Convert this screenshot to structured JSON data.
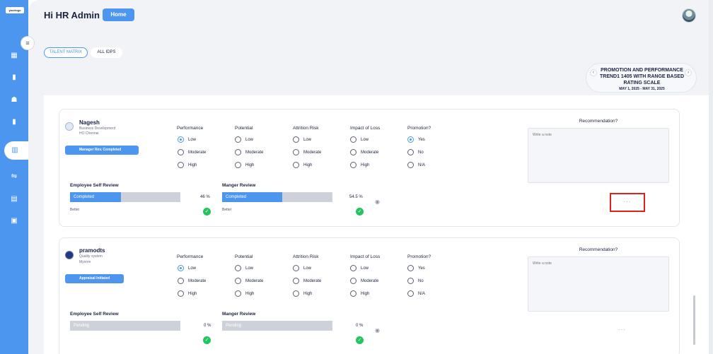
{
  "app": {
    "logo_text": "yourlogo"
  },
  "header": {
    "greeting": "Hi HR Admin",
    "home_label": "Home"
  },
  "tabs": [
    {
      "label": "TALENT MATRIX"
    },
    {
      "label": "ALL IDPS"
    }
  ],
  "cycle": {
    "title": "PROMOTION AND PERFORMANCE TREND1 1405 WITH RANGE BASED RATING SCALE",
    "dates": "MAY 1, 2025 - MAY 31, 2025"
  },
  "groups": [
    "Performance",
    "Potential",
    "Attrition Risk",
    "Impact of Loss",
    "Promotion?"
  ],
  "recommendation_label": "Recommendation?",
  "note_placeholder": "Write a note",
  "employees": [
    {
      "name": "Nagesh",
      "department": "Business Development",
      "location": "HO Chennai",
      "status": "Manager Rev. Completed",
      "performance": [
        "Low",
        "Moderate",
        "High"
      ],
      "potential": [
        "Low",
        "Moderate",
        "High"
      ],
      "attrition": [
        "Low",
        "Moderate",
        "High"
      ],
      "impact": [
        "Low",
        "Moderate",
        "High"
      ],
      "promotion": [
        "Yes",
        "No",
        "N/A"
      ],
      "self_review": {
        "label": "Employee Self Review",
        "status": "Completed",
        "percent": "46 %",
        "progress": 0.46,
        "rating": "Better"
      },
      "manager_review": {
        "label": "Manger Review",
        "status": "Completed",
        "percent": "54.5 %",
        "progress": 0.545,
        "rating": "Better"
      },
      "more": "···"
    },
    {
      "name": "pramodts",
      "department": "Quality system",
      "location": "Mysore",
      "status": "Appraisal Initiated",
      "performance": [
        "Low",
        "Moderate",
        "High"
      ],
      "potential": [
        "Low",
        "Moderate",
        "High"
      ],
      "attrition": [
        "Low",
        "Moderate",
        "High"
      ],
      "impact": [
        "Low",
        "Moderate",
        "High"
      ],
      "promotion": [
        "Yes",
        "No",
        "N/A"
      ],
      "self_review": {
        "label": "Employee Self Review",
        "status": "Pending",
        "percent": "0 %",
        "progress": 0,
        "rating": ""
      },
      "manager_review": {
        "label": "Manger Review",
        "status": "Pending",
        "percent": "0 %",
        "progress": 0,
        "rating": ""
      },
      "more": "···"
    }
  ],
  "colors": {
    "accent": "#4d96f0",
    "success": "#22c55e",
    "highlight": "#e0201c"
  }
}
